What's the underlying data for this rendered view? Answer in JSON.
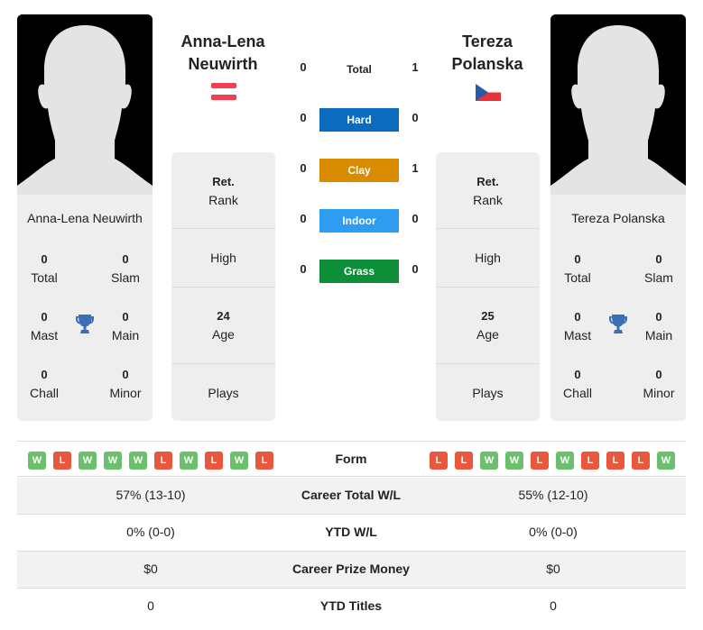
{
  "players": [
    {
      "name": "Anna-Lena Neuwirth",
      "name_line1": "Anna-Lena",
      "name_line2": "Neuwirth",
      "country_flag": "austria-flag",
      "titles": {
        "total": "0",
        "total_label": "Total",
        "slam": "0",
        "slam_label": "Slam",
        "mast": "0",
        "mast_label": "Mast",
        "main": "0",
        "main_label": "Main",
        "chall": "0",
        "chall_label": "Chall",
        "minor": "0",
        "minor_label": "Minor"
      },
      "info": {
        "rank_value": "Ret.",
        "rank_label": "Rank",
        "high_label": "High",
        "age_value": "24",
        "age_label": "Age",
        "plays_label": "Plays"
      },
      "form": [
        "W",
        "L",
        "W",
        "W",
        "W",
        "L",
        "W",
        "L",
        "W",
        "L"
      ],
      "career_total_wl": "57% (13-10)",
      "ytd_wl": "0% (0-0)",
      "career_prize_money": "$0",
      "ytd_titles": "0"
    },
    {
      "name": "Tereza Polanska",
      "name_line1": "Tereza",
      "name_line2": "Polanska",
      "country_flag": "czech-republic-flag",
      "titles": {
        "total": "0",
        "total_label": "Total",
        "slam": "0",
        "slam_label": "Slam",
        "mast": "0",
        "mast_label": "Mast",
        "main": "0",
        "main_label": "Main",
        "chall": "0",
        "chall_label": "Chall",
        "minor": "0",
        "minor_label": "Minor"
      },
      "info": {
        "rank_value": "Ret.",
        "rank_label": "Rank",
        "high_label": "High",
        "age_value": "25",
        "age_label": "Age",
        "plays_label": "Plays"
      },
      "form": [
        "L",
        "L",
        "W",
        "W",
        "L",
        "W",
        "L",
        "L",
        "L",
        "W"
      ],
      "career_total_wl": "55% (12-10)",
      "ytd_wl": "0% (0-0)",
      "career_prize_money": "$0",
      "ytd_titles": "0"
    }
  ],
  "h2h": {
    "total": {
      "label": "Total",
      "p1": "0",
      "p2": "1"
    },
    "surfaces": [
      {
        "label": "Hard",
        "p1": "0",
        "p2": "0",
        "color": "#0b6cbf"
      },
      {
        "label": "Clay",
        "p1": "0",
        "p2": "1",
        "color": "#d98b00"
      },
      {
        "label": "Indoor",
        "p1": "0",
        "p2": "0",
        "color": "#2e9cf0"
      },
      {
        "label": "Grass",
        "p1": "0",
        "p2": "0",
        "color": "#0d8f3a"
      }
    ]
  },
  "comparison": {
    "form_label": "Form",
    "rows": [
      {
        "label": "Career Total W/L"
      },
      {
        "label": "YTD W/L"
      },
      {
        "label": "Career Prize Money"
      },
      {
        "label": "YTD Titles"
      }
    ]
  },
  "colors": {
    "win": "#6cbf6c",
    "loss": "#e9573f",
    "trophy": "#3a6fb8"
  }
}
